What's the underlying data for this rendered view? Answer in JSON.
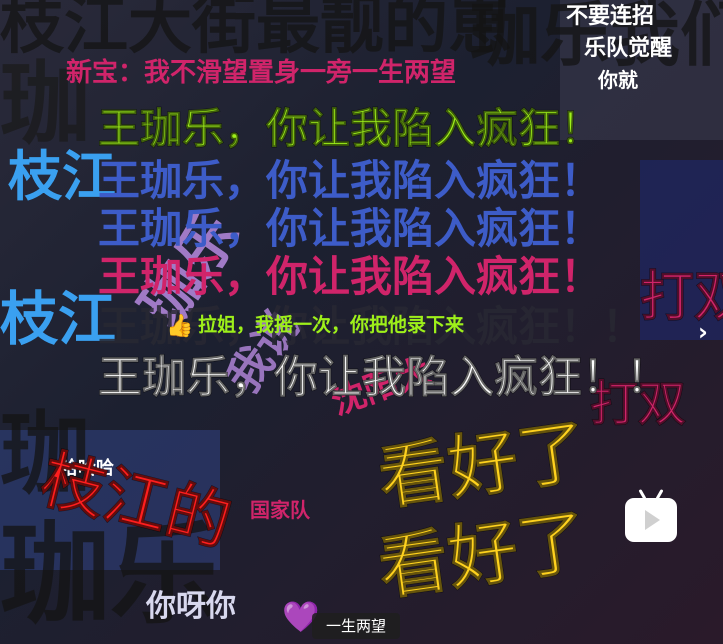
{
  "caption": "一生两望",
  "next_arrow": "›",
  "emoji": {
    "thumb": "👍",
    "heart": "💜"
  },
  "icons": {
    "tv": "tv-play-icon",
    "next": "chevron-right-icon"
  },
  "danmaku": {
    "main_line": "王珈乐，你让我陷入疯狂！！",
    "green_line": "王珈乐，你让我陷入疯狂！",
    "blue_line": "王珈乐，你让我陷入疯狂！",
    "pink_line": "王珈乐，你让我陷入疯狂！",
    "small_comment": "拉姐，我摇一次，你把他录下来",
    "look_good": "看好了",
    "look_good2": "看好了",
    "zhijiang": "枝江的",
    "zhijiang_left": "枝江",
    "zhijiang_left2": "枝江",
    "nini": "你呀你",
    "yisheng": "一生两望",
    "top_ghost": "枝江大街最靓的崽",
    "top_ghost2": "珈乐我们",
    "new_pink": "新宝：我不滑望置身一旁一生两望",
    "big_gray": "珈",
    "big_gray2": "珈",
    "big_gray3": "珈",
    "big_gray_bottom": "珈乐",
    "shuang": "打双",
    "jia": "珈乐",
    "top_right": "不要连招",
    "top_right2": "乐队觉醒",
    "top_right3": "你就",
    "guo_jia": "国家队",
    "shenyang": "沈阳大",
    "haha": "哈哈哈",
    "shen_pink": "我说"
  },
  "colors": {
    "green": "#9ef01a",
    "blue": "#3d5cc8",
    "pink": "#d0246a",
    "yellow": "#ffd21e",
    "red": "#ff1e1e",
    "white": "#ffffff",
    "violet": "#b78ae0",
    "skyblue": "#3aa0f0"
  }
}
